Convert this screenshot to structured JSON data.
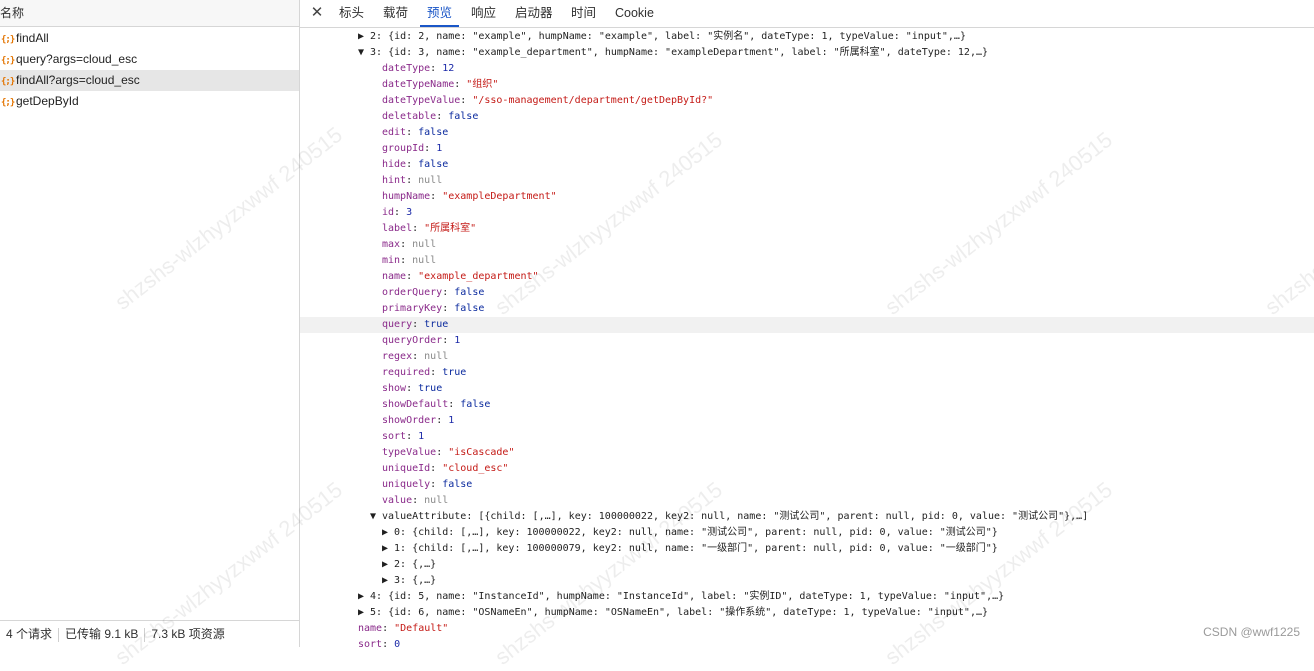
{
  "left": {
    "header": "名称",
    "requests": [
      {
        "icon": "{;}",
        "name": "findAll"
      },
      {
        "icon": "{;}",
        "name": "query?args=cloud_esc"
      },
      {
        "icon": "{;}",
        "name": "findAll?args=cloud_esc"
      },
      {
        "icon": "{;}",
        "name": "getDepById"
      }
    ],
    "status": {
      "requests": "4 个请求",
      "transferred": "已传输 9.1 kB",
      "resources": "7.3 kB 项资源"
    }
  },
  "tabs": {
    "close": "✕",
    "items": [
      "标头",
      "载荷",
      "预览",
      "响应",
      "启动器",
      "时间",
      "Cookie"
    ],
    "active": "预览"
  },
  "tree": {
    "item2": "▶ 2: {id: 2, name: \"example\", humpName: \"example\", label: \"实例名\", dateType: 1, typeValue: \"input\",…}",
    "item3": "▼ 3: {id: 3, name: \"example_department\", humpName: \"exampleDepartment\", label: \"所属科室\", dateType: 12,…}",
    "props": [
      {
        "k": "dateType",
        "v": "12",
        "t": "n"
      },
      {
        "k": "dateTypeName",
        "v": "\"组织\"",
        "t": "s"
      },
      {
        "k": "dateTypeValue",
        "v": "\"/sso-management/department/getDepById?\"",
        "t": "s"
      },
      {
        "k": "deletable",
        "v": "false",
        "t": "b"
      },
      {
        "k": "edit",
        "v": "false",
        "t": "b"
      },
      {
        "k": "groupId",
        "v": "1",
        "t": "n"
      },
      {
        "k": "hide",
        "v": "false",
        "t": "b"
      },
      {
        "k": "hint",
        "v": "null",
        "t": "nl"
      },
      {
        "k": "humpName",
        "v": "\"exampleDepartment\"",
        "t": "s"
      },
      {
        "k": "id",
        "v": "3",
        "t": "n"
      },
      {
        "k": "label",
        "v": "\"所属科室\"",
        "t": "s"
      },
      {
        "k": "max",
        "v": "null",
        "t": "nl"
      },
      {
        "k": "min",
        "v": "null",
        "t": "nl"
      },
      {
        "k": "name",
        "v": "\"example_department\"",
        "t": "s"
      },
      {
        "k": "orderQuery",
        "v": "false",
        "t": "b"
      },
      {
        "k": "primaryKey",
        "v": "false",
        "t": "b"
      },
      {
        "k": "query",
        "v": "true",
        "t": "b"
      },
      {
        "k": "queryOrder",
        "v": "1",
        "t": "n"
      },
      {
        "k": "regex",
        "v": "null",
        "t": "nl"
      },
      {
        "k": "required",
        "v": "true",
        "t": "b"
      },
      {
        "k": "show",
        "v": "true",
        "t": "b"
      },
      {
        "k": "showDefault",
        "v": "false",
        "t": "b"
      },
      {
        "k": "showOrder",
        "v": "1",
        "t": "n"
      },
      {
        "k": "sort",
        "v": "1",
        "t": "n"
      },
      {
        "k": "typeValue",
        "v": "\"isCascade\"",
        "t": "s"
      },
      {
        "k": "uniqueId",
        "v": "\"cloud_esc\"",
        "t": "s"
      },
      {
        "k": "uniquely",
        "v": "false",
        "t": "b"
      },
      {
        "k": "value",
        "v": "null",
        "t": "nl"
      }
    ],
    "valueAttribute": "▼ valueAttribute: [{child: [,…], key: 100000022, key2: null, name: \"测试公司\", parent: null, pid: 0, value: \"测试公司\"},…]",
    "va0": "▶ 0: {child: [,…], key: 100000022, key2: null, name: \"测试公司\", parent: null, pid: 0, value: \"测试公司\"}",
    "va1": "▶ 1: {child: [,…], key: 100000079, key2: null, name: \"一级部门\", parent: null, pid: 0, value: \"一级部门\"}",
    "va2": "▶ 2: {,…}",
    "va3": "▶ 3: {,…}",
    "item4": "▶ 4: {id: 5, name: \"InstanceId\", humpName: \"InstanceId\", label: \"实例ID\", dateType: 1, typeValue: \"input\",…}",
    "item5": "▶ 5: {id: 6, name: \"OSNameEn\", humpName: \"OSNameEn\", label: \"操作系统\", dateType: 1, typeValue: \"input\",…}",
    "nameKey": "name",
    "nameVal": "\"Default\"",
    "sortKey": "sort",
    "sortVal": "0"
  },
  "watermark": "shzshs-wlzhyyzxwwf 240515",
  "credit": "CSDN @wwf1225"
}
